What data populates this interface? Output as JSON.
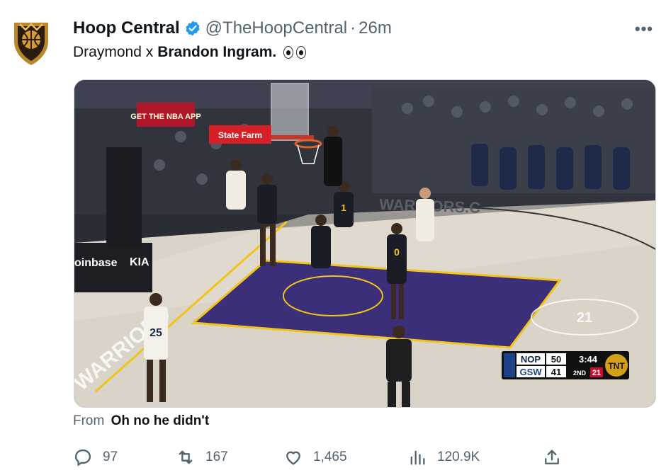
{
  "account": {
    "name": "Hoop Central",
    "handle": "@TheHoopCentral",
    "separator": "·",
    "time": "26m"
  },
  "tweet": {
    "text_prefix": "Draymond x",
    "text_bold": "Brandon Ingram.",
    "emoji_icon": "eyes-emoji"
  },
  "media": {
    "banner_app": "GET THE NBA APP",
    "banner_sponsor": "State Farm",
    "court_word": "WARRIORS.C",
    "court_word_near": "WARRIORS",
    "courtside_brand": "oinbase",
    "courtside_brand2": "KIA",
    "center_logo": "21",
    "jerseys": {
      "gsw_guard": "0",
      "gsw_forward": "1",
      "nop_player": "25"
    },
    "scoreboard": {
      "team1": "NOP",
      "score1": "50",
      "team2": "GSW",
      "score2": "41",
      "clock": "3:44",
      "period": "2ND",
      "shot_clock": "21",
      "network": "TNT"
    }
  },
  "source": {
    "prefix": "From",
    "name": "Oh no he didn't"
  },
  "actions": {
    "replies": "97",
    "retweets": "167",
    "likes": "1,465",
    "views": "120.9K"
  },
  "colors": {
    "verified": "#1d9bf0",
    "muted": "#536471",
    "text": "#0f1419",
    "court_paint": "#3a2f78",
    "court_line": "#f2c318"
  }
}
